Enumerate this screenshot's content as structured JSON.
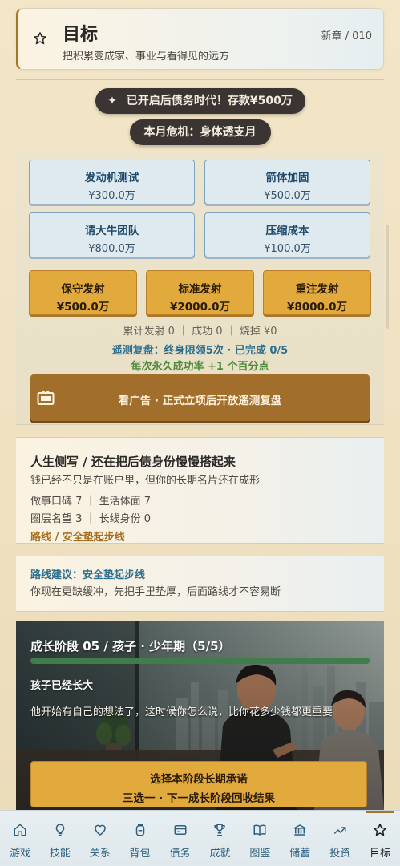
{
  "header": {
    "title": "目标",
    "subtitle": "把积累变成家、事业与看得见的远方",
    "chapter": "新章 / 010"
  },
  "pills": {
    "debt_era": "已开启后债务时代！存款¥500万",
    "crisis": "本月危机：身体透支月"
  },
  "rocket": {
    "options": [
      {
        "label": "发动机测试",
        "cost": "¥300.0万"
      },
      {
        "label": "箭体加固",
        "cost": "¥500.0万"
      },
      {
        "label": "请大牛团队",
        "cost": "¥800.0万"
      },
      {
        "label": "压缩成本",
        "cost": "¥100.0万"
      }
    ],
    "launches": [
      {
        "label": "保守发射",
        "cost": "¥500.0万"
      },
      {
        "label": "标准发射",
        "cost": "¥2000.0万"
      },
      {
        "label": "重注发射",
        "cost": "¥8000.0万"
      }
    ],
    "stats": "累计发射 0 ｜ 成功 0 ｜ 烧掉 ¥0",
    "replay": "遥测复盘：终身限领5次 · 已完成 0/5",
    "bonus": "每次永久成功率 +1 个百分点",
    "ad_button": "看广告 · 正式立项后开放遥测复盘"
  },
  "life": {
    "title": "人生侧写 / 还在把后债身份慢慢搭起来",
    "desc": "钱已经不只是在账户里，但你的长期名片还在成形",
    "row1": "做事口碑 7 ｜ 生活体面 7",
    "row2": "圈层名望 3 ｜ 长线身份 0",
    "route": "路线 / 安全垫起步线"
  },
  "advice": {
    "title": "路线建议：安全垫起步线",
    "desc": "你现在更缺缓冲，先把手里垫厚，后面路线才不容易断"
  },
  "growth": {
    "title": "成长阶段 05 / 孩子 · 少年期（5/5）",
    "progress": 1.0,
    "event": "孩子已经长大",
    "desc": "他开始有自己的想法了，这时候你怎么说，比你花多少钱都更重要",
    "commit_line1": "选择本阶段长期承诺",
    "commit_line2": "三选一 · 下一成长阶段回收结果"
  },
  "nav": [
    {
      "label": "游戏",
      "icon": "home-icon"
    },
    {
      "label": "技能",
      "icon": "bulb-icon"
    },
    {
      "label": "关系",
      "icon": "heart-icon"
    },
    {
      "label": "背包",
      "icon": "backpack-icon"
    },
    {
      "label": "债务",
      "icon": "card-icon"
    },
    {
      "label": "成就",
      "icon": "trophy-icon"
    },
    {
      "label": "图鉴",
      "icon": "book-icon"
    },
    {
      "label": "储蓄",
      "icon": "bank-icon"
    },
    {
      "label": "投资",
      "icon": "trend-icon"
    },
    {
      "label": "目标",
      "icon": "star-icon",
      "active": true
    }
  ],
  "colors": {
    "accent_gold": "#e2a93c",
    "ad_brown": "#a26e2c",
    "info_blue": "#2d6f8e",
    "success_green": "#4f8a3c",
    "pill_dark": "#3a3532"
  }
}
